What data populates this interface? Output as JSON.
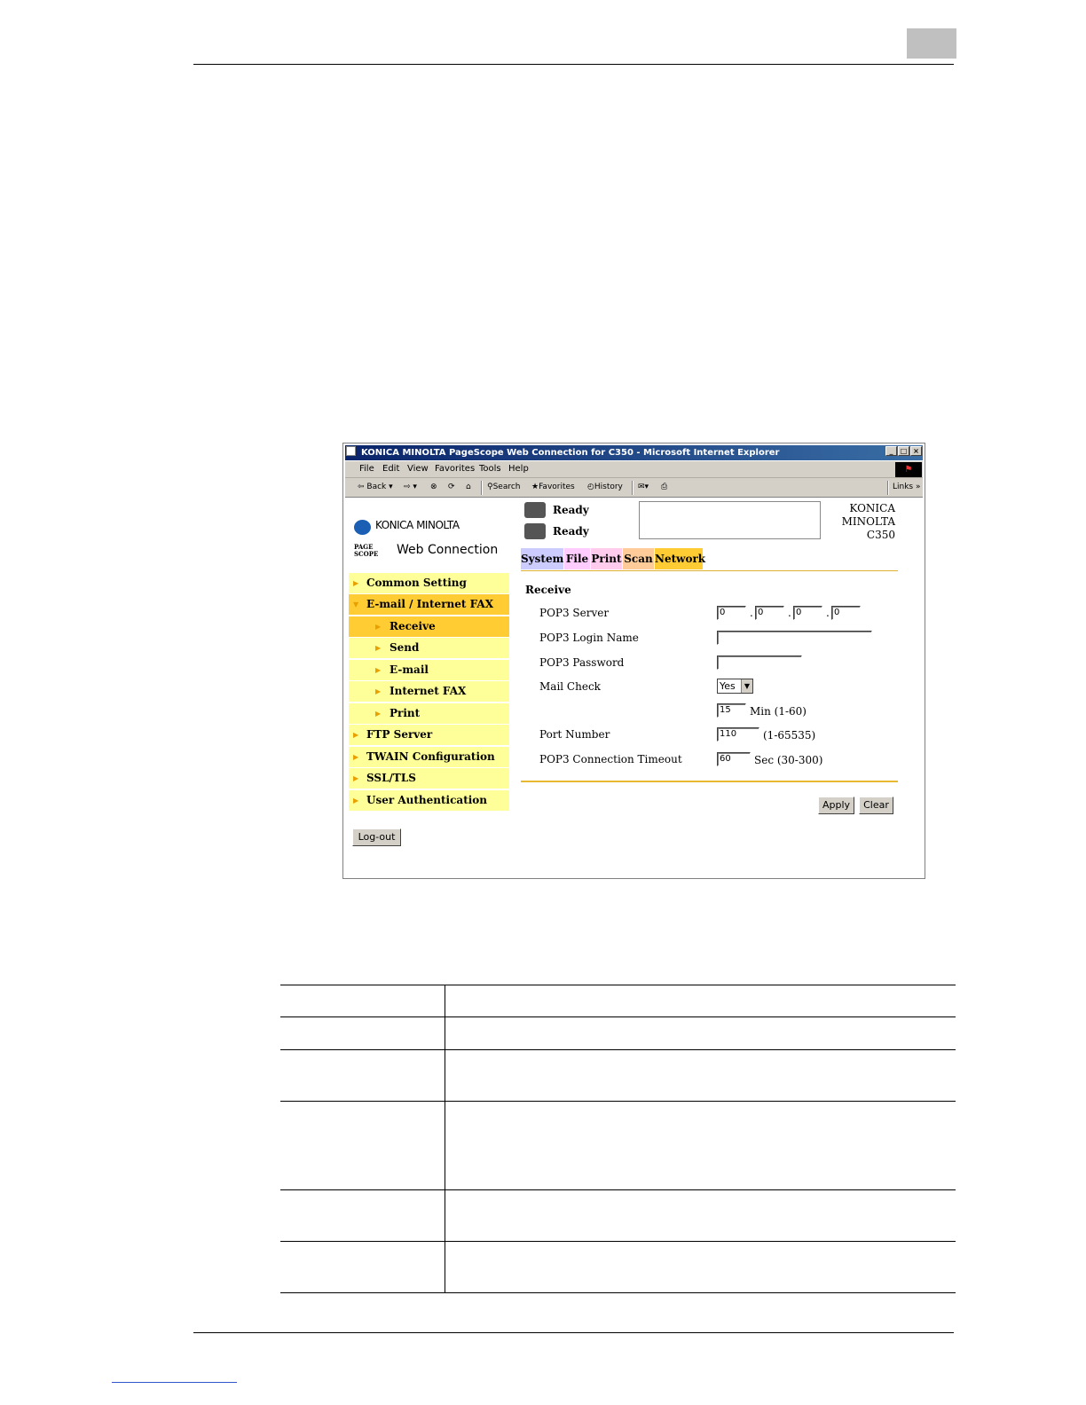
{
  "browser": {
    "title": "KONICA MINOLTA PageScope Web Connection for C350 - Microsoft Internet Explorer",
    "window_buttons": [
      "_",
      "□",
      "×"
    ],
    "menu": [
      "File",
      "Edit",
      "View",
      "Favorites",
      "Tools",
      "Help"
    ],
    "toolbar": {
      "back": "Back",
      "search": "Search",
      "favorites": "Favorites",
      "history": "History",
      "links": "Links"
    }
  },
  "header": {
    "brand": "KONICA MINOLTA",
    "pagescope_mark": "PAGE SCOPE",
    "product": "Web Connection",
    "status": [
      "Ready",
      "Ready"
    ],
    "model_lines": [
      "KONICA",
      "MINOLTA",
      "C350"
    ]
  },
  "tabs": [
    {
      "label": "System",
      "color": "#ccccff"
    },
    {
      "label": "File",
      "color": "#ffccff"
    },
    {
      "label": "Print",
      "color": "#ffccee"
    },
    {
      "label": "Scan",
      "color": "#ffcc99"
    },
    {
      "label": "Network",
      "color": "#ffcc33"
    }
  ],
  "sidebar": {
    "items": [
      {
        "label": "Common Setting"
      },
      {
        "label": "E-mail / Internet FAX"
      },
      {
        "label": "Receive"
      },
      {
        "label": "Send"
      },
      {
        "label": "E-mail"
      },
      {
        "label": "Internet FAX"
      },
      {
        "label": "Print"
      },
      {
        "label": "FTP Server"
      },
      {
        "label": "TWAIN Configuration"
      },
      {
        "label": "SSL/TLS"
      },
      {
        "label": "User Authentication"
      }
    ],
    "logout": "Log-out"
  },
  "form": {
    "section_title": "Receive",
    "pop3_server_label": "POP3 Server",
    "pop3_server": [
      "0",
      "0",
      "0",
      "0"
    ],
    "login_label": "POP3 Login Name",
    "login_value": "",
    "password_label": "POP3 Password",
    "password_value": "",
    "mail_check_label": "Mail Check",
    "mail_check_value": "Yes",
    "interval_value": "15",
    "interval_unit": "Min (1-60)",
    "port_label": "Port Number",
    "port_value": "110",
    "port_range": "(1-65535)",
    "timeout_label": "POP3 Connection Timeout",
    "timeout_value": "60",
    "timeout_unit": "Sec (30-300)",
    "apply": "Apply",
    "clear": "Clear"
  },
  "colors": {
    "sidebar_bg": "#ffff99",
    "sidebar_active": "#ffcc33",
    "accent_line": "#e8b830"
  }
}
